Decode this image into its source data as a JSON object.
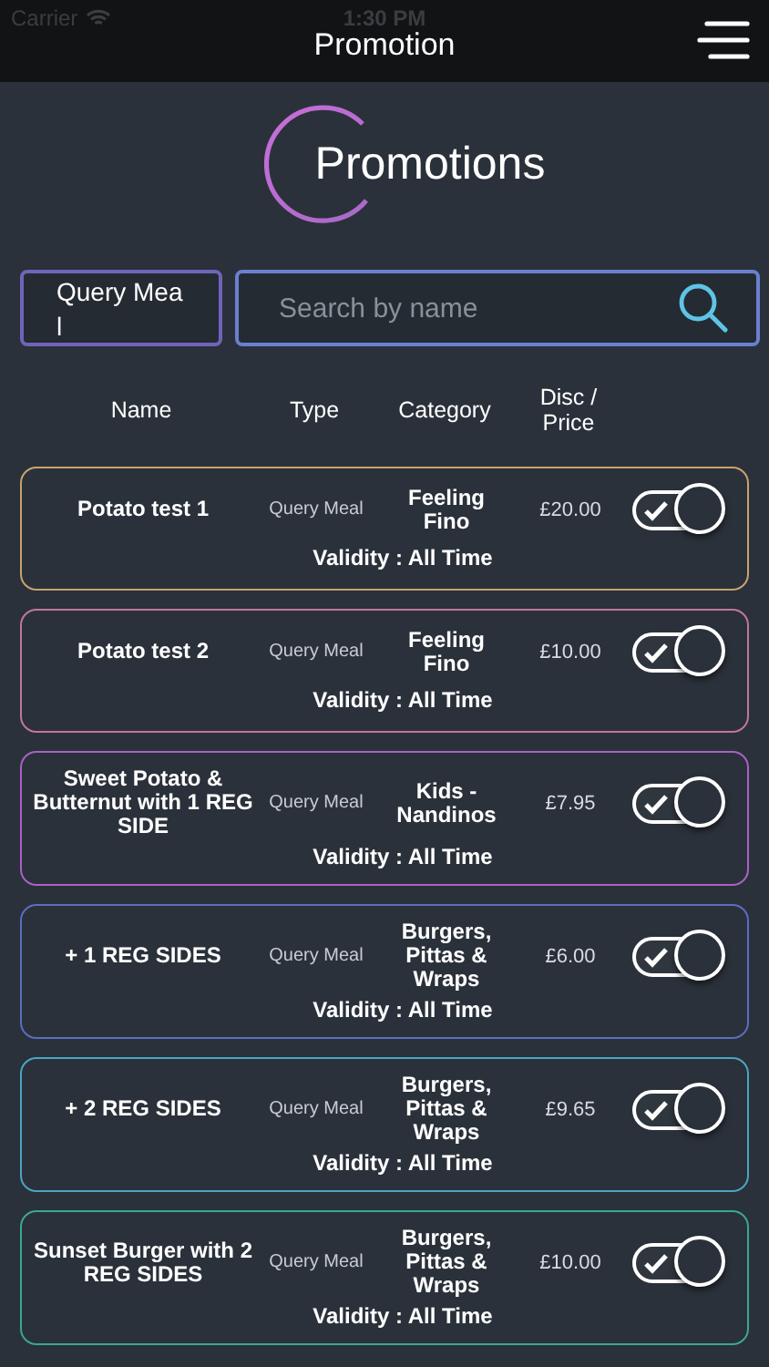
{
  "status_bar": {
    "carrier": "Carrier",
    "time": "1:30 PM"
  },
  "nav": {
    "title": "Promotion"
  },
  "heading": "Promotions",
  "filter": {
    "value": "Query Meal"
  },
  "search": {
    "placeholder": "Search by name"
  },
  "columns": [
    "Name",
    "Type",
    "Category",
    "Disc / Price"
  ],
  "promotions": [
    {
      "name": "Potato test 1",
      "type": "Query Meal",
      "category": "Feeling Fino",
      "price": "£20.00",
      "validity": "Validity : All Time",
      "on": true,
      "color": "#c9a26e"
    },
    {
      "name": "Potato test 2",
      "type": "Query Meal",
      "category": "Feeling Fino",
      "price": "£10.00",
      "validity": "Validity : All Time",
      "on": true,
      "color": "#c4759e"
    },
    {
      "name": "Sweet Potato & Butternut with 1 REG SIDE",
      "type": "Query Meal",
      "category": "Kids - Nandinos",
      "price": "£7.95",
      "validity": "Validity : All Time",
      "on": true,
      "color": "#a862c4"
    },
    {
      "name": "+ 1 REG SIDES",
      "type": "Query Meal",
      "category": "Burgers, Pittas & Wraps",
      "price": "£6.00",
      "validity": "Validity : All Time",
      "on": true,
      "color": "#5c6cc4"
    },
    {
      "name": "+ 2 REG SIDES",
      "type": "Query Meal",
      "category": "Burgers, Pittas & Wraps",
      "price": "£9.65",
      "validity": "Validity : All Time",
      "on": true,
      "color": "#4aa6c2"
    },
    {
      "name": "Sunset Burger with 2 REG SIDES",
      "type": "Query Meal",
      "category": "Burgers, Pittas & Wraps",
      "price": "£10.00",
      "validity": "Validity : All Time",
      "on": true,
      "color": "#3aa890"
    }
  ]
}
